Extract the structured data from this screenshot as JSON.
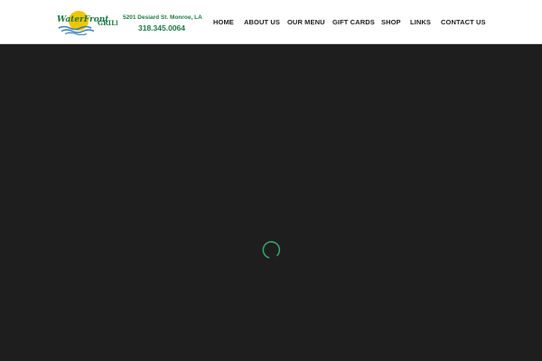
{
  "header": {
    "logo": {
      "text": "WaterFront Grill",
      "icon": "sun-over-water-logo",
      "sun_color": "#f2c500",
      "text_color": "#1f7a45",
      "water_color": "#3a7fc1"
    },
    "address": "5201 Desiard St. Monroe, LA",
    "phone": "318.345.0064"
  },
  "nav": {
    "items": [
      {
        "label": "HOME"
      },
      {
        "label": "ABOUT US"
      },
      {
        "label": "OUR MENU"
      },
      {
        "label": "GIFT CARDS"
      },
      {
        "label": "SHOP"
      },
      {
        "label": "LINKS"
      },
      {
        "label": "CONTACT US"
      }
    ]
  },
  "main": {
    "background": "#1e1e1e",
    "loader": {
      "icon": "loading-spinner-icon",
      "color": "#2fa56a"
    }
  },
  "colors": {
    "brand_green": "#1f7a45",
    "nav_text": "#222222",
    "header_bg": "#ffffff"
  }
}
